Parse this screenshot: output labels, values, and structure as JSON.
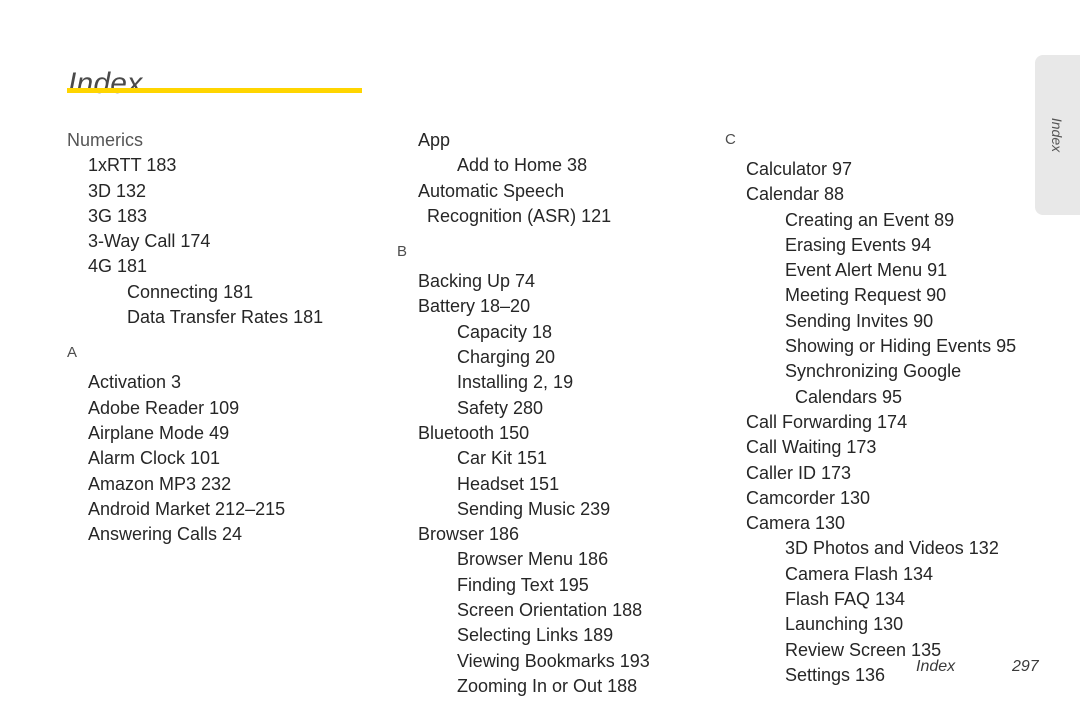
{
  "title": "Index",
  "accent_color": "#ffd500",
  "side_tab": {
    "label": "Index",
    "background_color": "#e8e8e8"
  },
  "footer": {
    "label": "Index",
    "page_number": "297"
  },
  "columns": [
    {
      "id": "column-1",
      "entries": [
        {
          "text": "Numerics",
          "level": "head"
        },
        {
          "text": "1xRTT 183",
          "level": "1"
        },
        {
          "text": "3D 132",
          "level": "1"
        },
        {
          "text": "3G 183",
          "level": "1"
        },
        {
          "text": "3-Way Call 174",
          "level": "1"
        },
        {
          "text": "4G 181",
          "level": "1"
        },
        {
          "text": "Connecting 181",
          "level": "2"
        },
        {
          "text": "Data Transfer Rates 181",
          "level": "2"
        },
        {
          "text": "A",
          "level": "letter"
        },
        {
          "text": "Activation 3",
          "level": "1"
        },
        {
          "text": "Adobe Reader 109",
          "level": "1"
        },
        {
          "text": "Airplane Mode 49",
          "level": "1"
        },
        {
          "text": "Alarm Clock 101",
          "level": "1"
        },
        {
          "text": "Amazon MP3 232",
          "level": "1"
        },
        {
          "text": "Android Market 212–215",
          "level": "1"
        },
        {
          "text": "Answering Calls 24",
          "level": "1"
        }
      ]
    },
    {
      "id": "column-2",
      "entries": [
        {
          "text": "App",
          "level": "1"
        },
        {
          "text": "Add to Home 38",
          "level": "2"
        },
        {
          "text": "Automatic Speech",
          "level": "1"
        },
        {
          "text": "Recognition (ASR) 121",
          "level": "1w"
        },
        {
          "text": "B",
          "level": "letter"
        },
        {
          "text": "Backing Up 74",
          "level": "1"
        },
        {
          "text": "Battery 18–20",
          "level": "1"
        },
        {
          "text": "Capacity 18",
          "level": "2"
        },
        {
          "text": "Charging 20",
          "level": "2"
        },
        {
          "text": "Installing 2, 19",
          "level": "2"
        },
        {
          "text": "Safety 280",
          "level": "2"
        },
        {
          "text": "Bluetooth 150",
          "level": "1"
        },
        {
          "text": "Car Kit 151",
          "level": "2"
        },
        {
          "text": "Headset 151",
          "level": "2"
        },
        {
          "text": "Sending Music 239",
          "level": "2"
        },
        {
          "text": "Browser 186",
          "level": "1"
        },
        {
          "text": "Browser Menu 186",
          "level": "2"
        },
        {
          "text": "Finding Text 195",
          "level": "2"
        },
        {
          "text": "Screen Orientation 188",
          "level": "2"
        },
        {
          "text": "Selecting Links 189",
          "level": "2"
        },
        {
          "text": "Viewing Bookmarks 193",
          "level": "2"
        },
        {
          "text": "Zooming In or Out 188",
          "level": "2"
        }
      ]
    },
    {
      "id": "column-3",
      "entries": [
        {
          "text": "C",
          "level": "letter-top"
        },
        {
          "text": "Calculator 97",
          "level": "1"
        },
        {
          "text": "Calendar 88",
          "level": "1"
        },
        {
          "text": "Creating an Event 89",
          "level": "2"
        },
        {
          "text": "Erasing Events 94",
          "level": "2"
        },
        {
          "text": "Event Alert Menu 91",
          "level": "2"
        },
        {
          "text": "Meeting Request 90",
          "level": "2"
        },
        {
          "text": "Sending Invites 90",
          "level": "2"
        },
        {
          "text": "Showing or Hiding Events 95",
          "level": "2"
        },
        {
          "text": "Synchronizing Google",
          "level": "2"
        },
        {
          "text": "Calendars 95",
          "level": "2w"
        },
        {
          "text": "Call Forwarding 174",
          "level": "1"
        },
        {
          "text": "Call Waiting 173",
          "level": "1"
        },
        {
          "text": "Caller ID 173",
          "level": "1"
        },
        {
          "text": "Camcorder 130",
          "level": "1"
        },
        {
          "text": "Camera 130",
          "level": "1"
        },
        {
          "text": "3D Photos and Videos 132",
          "level": "2"
        },
        {
          "text": "Camera Flash 134",
          "level": "2"
        },
        {
          "text": "Flash FAQ 134",
          "level": "2"
        },
        {
          "text": "Launching 130",
          "level": "2"
        },
        {
          "text": "Review Screen 135",
          "level": "2"
        },
        {
          "text": "Settings 136",
          "level": "2"
        }
      ]
    }
  ]
}
